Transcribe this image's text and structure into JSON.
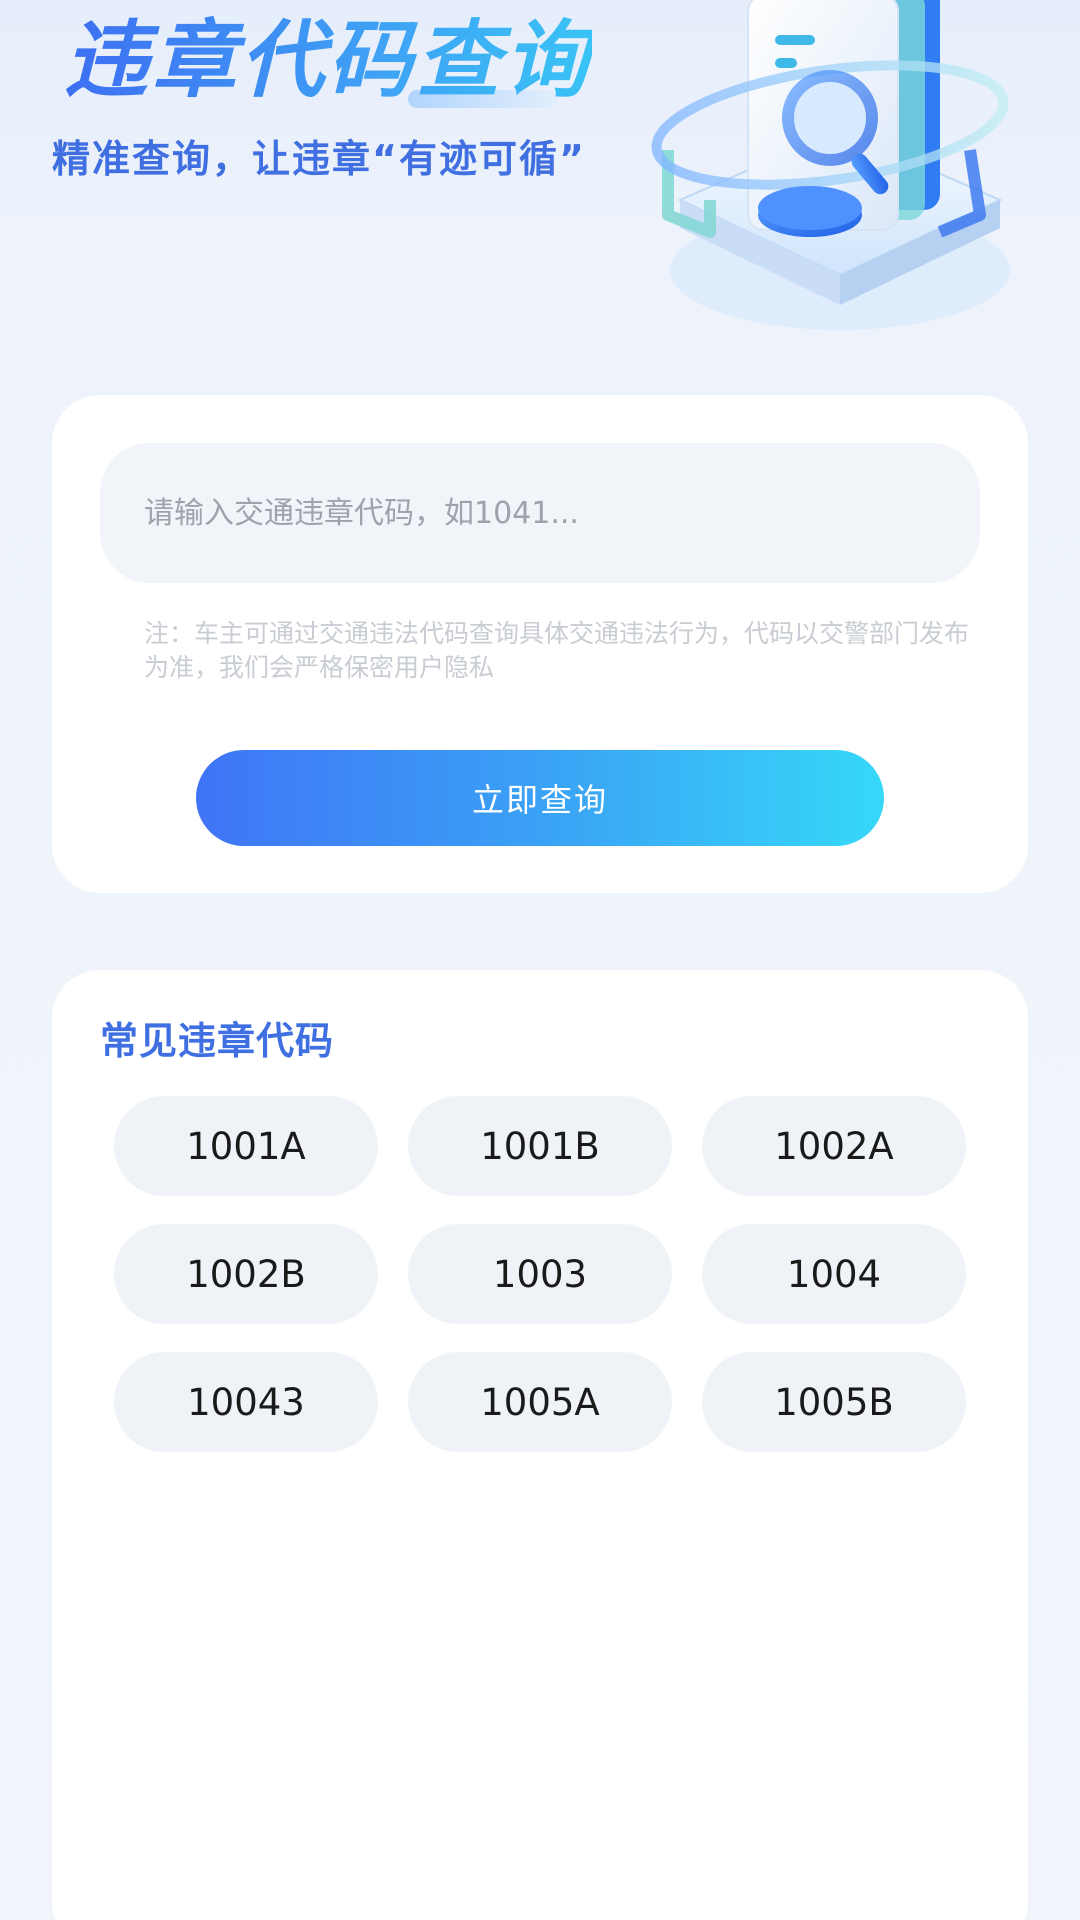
{
  "header": {
    "title": "违章代码查询",
    "subtitle": "精准查询，让违章“有迹可循”",
    "hero_icon": "document-search-illustration"
  },
  "search": {
    "placeholder": "请输入交通违章代码，如1041...",
    "value": "",
    "note": "注：车主可通过交通违法代码查询具体交通违法行为，代码以交警部门发布为准，我们会严格保密用户隐私",
    "button_label": "立即查询"
  },
  "codes": {
    "title": "常见违章代码",
    "items": [
      "1001A",
      "1001B",
      "1002A",
      "1002B",
      "1003",
      "1004",
      "10043",
      "1005A",
      "1005B"
    ]
  },
  "colors": {
    "accent": "#3f6fe0",
    "button_gradient_start": "#3f74f6",
    "button_gradient_end": "#36d8f8",
    "background": "#eef3fb"
  }
}
